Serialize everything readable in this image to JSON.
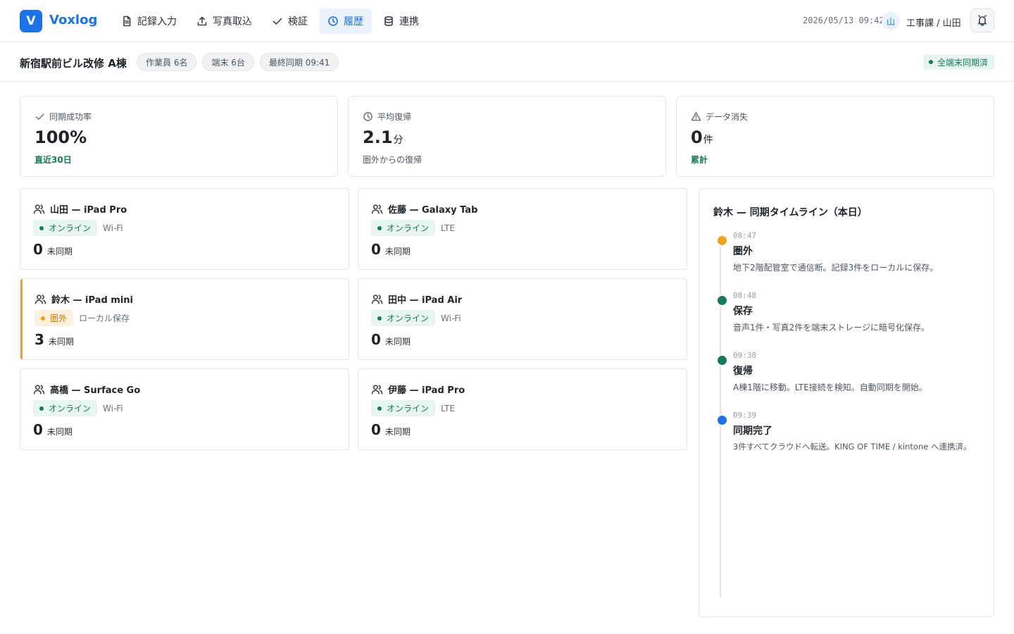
{
  "app": {
    "logo_letter": "V",
    "brand": "Voxlog"
  },
  "nav": [
    {
      "label": "記録入力",
      "icon": "document-icon",
      "active": false
    },
    {
      "label": "写真取込",
      "icon": "upload-icon",
      "active": false
    },
    {
      "label": "検証",
      "icon": "check-icon",
      "active": false
    },
    {
      "label": "履歴",
      "icon": "clock-icon",
      "active": true
    },
    {
      "label": "連携",
      "icon": "database-icon",
      "active": false
    }
  ],
  "header": {
    "datetime": "2026/05/13 09:42",
    "avatar": "山",
    "user": "工事課 / 山田"
  },
  "project": {
    "title": "新宿駅前ビル改修 A棟",
    "chips": [
      "作業員 6名",
      "端末 6台",
      "最終同期 09:41"
    ],
    "sync_status": "全端末同期済"
  },
  "stats": [
    {
      "label": "同期成功率",
      "icon": "check-icon",
      "value": "100%",
      "unit": "",
      "sub": "直近30日",
      "sub_style": "green"
    },
    {
      "label": "平均復帰",
      "icon": "clock-icon",
      "value": "2.1",
      "unit": "分",
      "sub": "圏外からの復帰",
      "sub_style": "gray"
    },
    {
      "label": "データ消失",
      "icon": "warning-icon",
      "value": "0",
      "unit": "件",
      "sub": "累計",
      "sub_style": "green"
    }
  ],
  "devices": [
    {
      "name": "山田 — iPad Pro",
      "status": "オンライン",
      "online": true,
      "connection": "Wi-Fi",
      "unsynced": "0",
      "unsynced_label": "未同期"
    },
    {
      "name": "佐藤 — Galaxy Tab",
      "status": "オンライン",
      "online": true,
      "connection": "LTE",
      "unsynced": "0",
      "unsynced_label": "未同期"
    },
    {
      "name": "鈴木 — iPad mini",
      "status": "圏外",
      "online": false,
      "connection": "ローカル保存",
      "unsynced": "3",
      "unsynced_label": "未同期"
    },
    {
      "name": "田中 — iPad Air",
      "status": "オンライン",
      "online": true,
      "connection": "Wi-Fi",
      "unsynced": "0",
      "unsynced_label": "未同期"
    },
    {
      "name": "高橋 — Surface Go",
      "status": "オンライン",
      "online": true,
      "connection": "Wi-Fi",
      "unsynced": "0",
      "unsynced_label": "未同期"
    },
    {
      "name": "伊藤 — iPad Pro",
      "status": "オンライン",
      "online": true,
      "connection": "LTE",
      "unsynced": "0",
      "unsynced_label": "未同期"
    }
  ],
  "timeline": {
    "title": "鈴木 — 同期タイムライン（本日）",
    "events": [
      {
        "time": "08:47",
        "title": "圏外",
        "desc": "地下2階配管室で通信断。記録3件をローカルに保存。",
        "color": "#f0a21b"
      },
      {
        "time": "08:48",
        "title": "保存",
        "desc": "音声1件・写真2件を端末ストレージに暗号化保存。",
        "color": "#137a5a"
      },
      {
        "time": "09:38",
        "title": "復帰",
        "desc": "A棟1階に移動。LTE接続を検知。自動同期を開始。",
        "color": "#137a5a"
      },
      {
        "time": "09:39",
        "title": "同期完了",
        "desc": "3件すべてクラウドへ転送。KING OF TIME / kintone へ連携済。",
        "color": "#1a73e8"
      }
    ]
  }
}
